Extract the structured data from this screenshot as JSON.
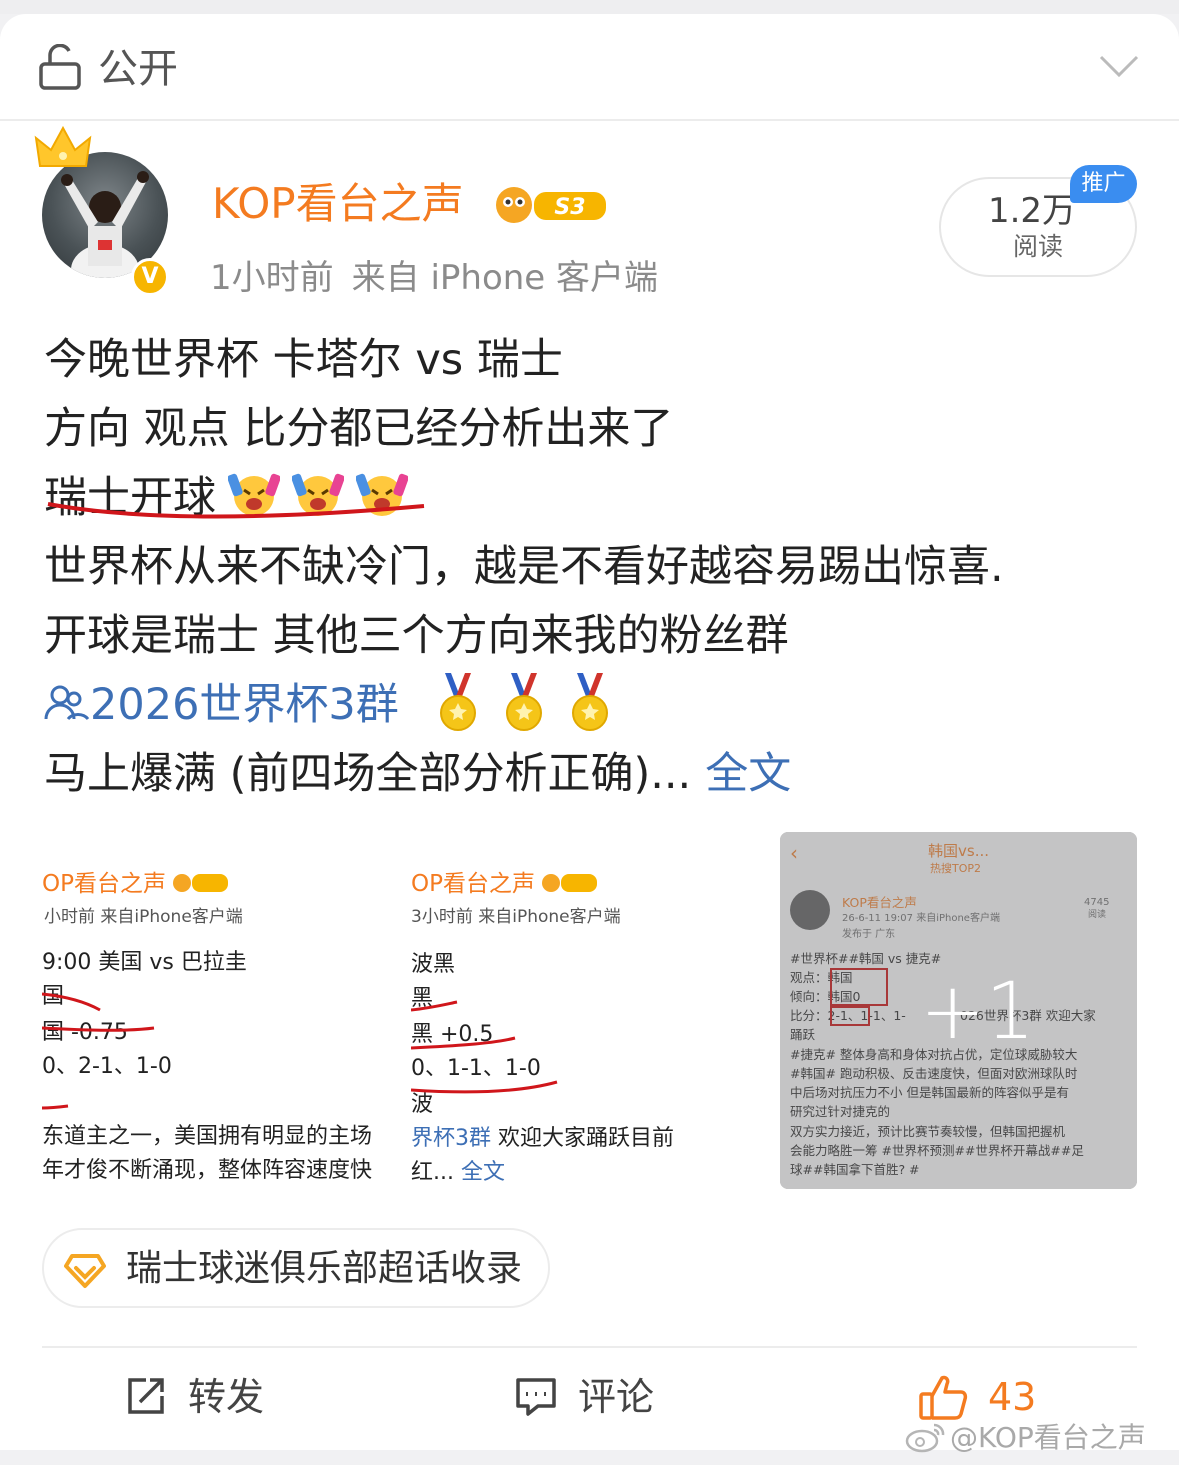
{
  "visibility": {
    "label": "公开"
  },
  "author": {
    "name": "KOP看台之声",
    "level_badge": "S3",
    "time": "1小时前",
    "source": "来自 iPhone 客户端",
    "verified_mark": "V"
  },
  "stats": {
    "reads_count": "1.2万",
    "reads_label": "阅读",
    "promo_tag": "推广"
  },
  "post": {
    "lines": [
      "今晚世界杯 卡塔尔 vs 瑞士",
      "方向 观点 比分都已经分析出来了",
      "瑞士开球",
      "世界杯从来不缺冷门，越是不看好越容易踢出惊喜.",
      "开球是瑞士 其他三个方向来我的粉丝群"
    ],
    "group_link": "2026世界杯3群",
    "last_line": "马上爆满 (前四场全部分析正确)...",
    "full_text": "全文"
  },
  "images": [
    {
      "name": "OP看台之声",
      "meta": "小时前  来自iPhone客户端",
      "lines": [
        "9:00 美国 vs 巴拉圭",
        "国",
        "国 -0.75",
        "0、2-1、1-0",
        "东道主之一，美国拥有明显的主场",
        "年才俊不断涌现，整体阵容速度快"
      ]
    },
    {
      "name": "OP看台之声",
      "meta": "3小时前  来自iPhone客户端",
      "lines": [
        "波黑",
        "黑",
        "黑 +0.5",
        "0、1-1、1-0",
        "波"
      ],
      "link": "界杯3群",
      "tail": " 欢迎大家踊跃",
      "tail2": "目前",
      "last": "红...",
      "full": "全文"
    },
    {
      "title": "韩国vs...",
      "subtitle": "热搜TOP2",
      "author": "KOP看台之声",
      "date": "26-6-11 19:07  来自iPhone客户端",
      "location": "发布于 广东",
      "reads": "4745",
      "reads_label": "阅读",
      "lines": [
        "#世界杯##韩国 vs 捷克#",
        "观点：韩国",
        "倾向：韩国0",
        "比分：2-1、1-1、1-",
        "026世界杯3群 欢迎大家",
        "踊跃",
        "#捷克# 整体身高和身体对抗占优，定位球威胁较大",
        "#韩国# 跑动积极、反击速度快，但面对欧洲球队时",
        "中后场对抗压力不小 但是韩国最新的阵容似乎是有",
        "研究过针对捷克的",
        "双方实力接近，预计比赛节奏较慢，但韩国把握机",
        "会能力略胜一筹 #世界杯预测##世界杯开幕战##足",
        "球##韩国拿下首胜? #"
      ],
      "more": "+1"
    }
  ],
  "topic": {
    "label": "瑞士球迷俱乐部超话收录"
  },
  "actions": {
    "repost": "转发",
    "comment": "评论",
    "like_count": "43"
  },
  "watermark": "@KOP看台之声",
  "colors": {
    "brand_orange": "#f47b20",
    "link_blue": "#3d6fb5",
    "promo_blue": "#3a8df0",
    "gold": "#f7b500"
  }
}
